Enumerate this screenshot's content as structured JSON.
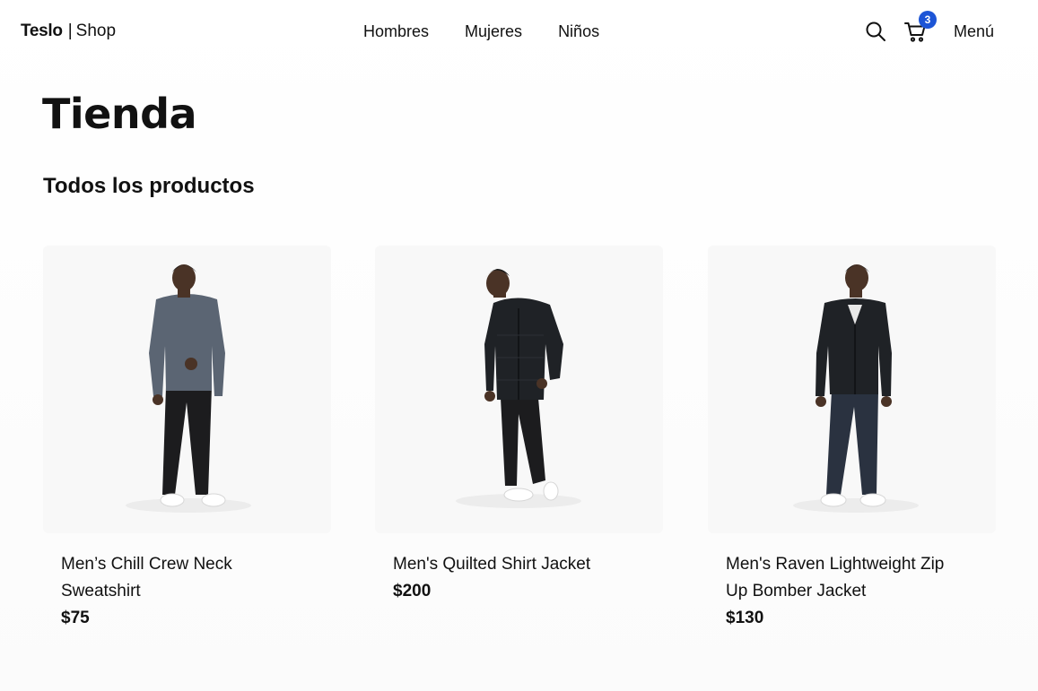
{
  "header": {
    "brand": "Teslo",
    "separator": "|",
    "shop": "Shop",
    "nav": [
      {
        "label": "Hombres"
      },
      {
        "label": "Mujeres"
      },
      {
        "label": "Niños"
      }
    ],
    "cart_count": "3",
    "menu_label": "Menú"
  },
  "main": {
    "title": "Tienda",
    "subtitle": "Todos los productos"
  },
  "products": [
    {
      "title": "Men’s Chill Crew Neck Sweatshirt",
      "price": "$75"
    },
    {
      "title": "Men's Quilted Shirt Jacket",
      "price": "$200"
    },
    {
      "title": "Men's Raven Lightweight Zip Up Bomber Jacket",
      "price": "$130"
    }
  ],
  "colors": {
    "badge": "#1d55d6",
    "card_bg": "#f8f8f8",
    "sweatshirt": "#5b6573",
    "jacket": "#1f2226"
  },
  "icons": {
    "search": "search-icon",
    "cart": "cart-icon"
  }
}
